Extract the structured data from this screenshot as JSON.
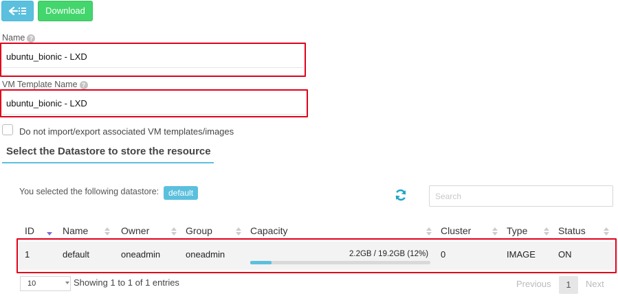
{
  "toolbar": {
    "back_icon": "arrow-left-list-icon",
    "download_label": "Download",
    "back_color": "#5bc0de",
    "download_color": "#43d66d"
  },
  "form": {
    "name_label": "Name",
    "name_value": "ubuntu_bionic - LXD",
    "template_label": "VM Template Name",
    "template_value": "ubuntu_bionic - LXD",
    "checkbox_label": "Do not import/export associated VM templates/images",
    "checkbox_checked": false,
    "help_icon": "question-circle-icon"
  },
  "datastore": {
    "section_title": "Select the Datastore to store the resource",
    "selected_text": "You selected the following datastore:",
    "selected_badge": "default",
    "refresh_icon": "refresh-icon",
    "search_placeholder": "Search"
  },
  "table": {
    "columns": [
      "ID",
      "Name",
      "Owner",
      "Group",
      "Capacity",
      "Cluster",
      "Type",
      "Status"
    ],
    "rows": [
      {
        "id": "1",
        "name": "default",
        "owner": "oneadmin",
        "group": "oneadmin",
        "capacity_text": "2.2GB / 19.2GB (12%)",
        "capacity_fraction": 0.12,
        "cluster": "0",
        "type": "IMAGE",
        "status": "ON"
      }
    ]
  },
  "footer": {
    "page_length": "10",
    "info": "Showing 1 to 1 of 1 entries",
    "prev_label": "Previous",
    "current_page": "1",
    "next_label": "Next"
  },
  "colors": {
    "accent": "#5bc0de",
    "highlight_border": "#e0001a",
    "success": "#43d66d"
  }
}
